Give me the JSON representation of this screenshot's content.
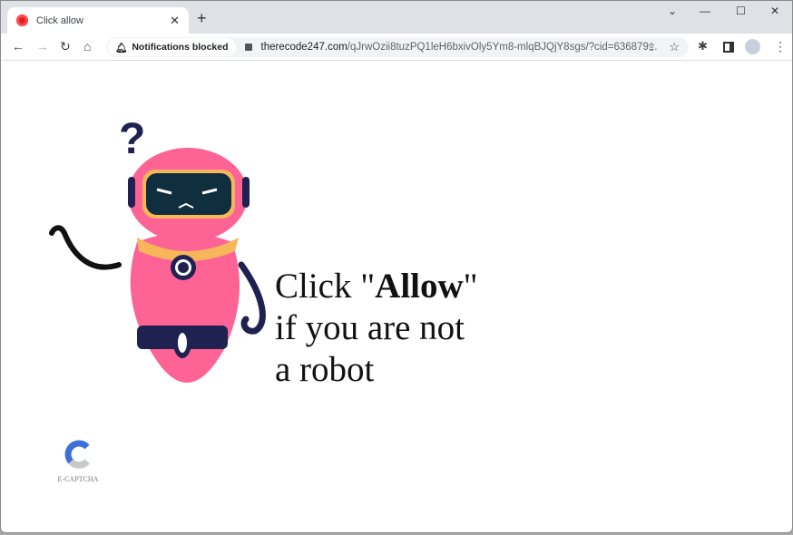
{
  "tab": {
    "title": "Click allow",
    "close": "✕",
    "new_tab": "+"
  },
  "window": {
    "dropdown": "⌄",
    "minimize": "—",
    "maximize": "☐",
    "close": "✕"
  },
  "toolbar": {
    "back": "←",
    "forward": "→",
    "reload": "↻",
    "home": "⌂",
    "notifications_chip": "Notifications blocked",
    "url_domain": "therecode247.com",
    "url_path": "/qJrwOzii8tuzPQ1leH6bxivOly5Ym8-mlqBJQjY8sgs/?cid=636879..."
  },
  "page": {
    "line1_pre": "Click \"",
    "line1_bold": "Allow",
    "line1_post": "\"",
    "line2": "if you are not",
    "line3": "a robot",
    "question_mark": "?",
    "logo_text": "E-CAPTCHA"
  },
  "colors": {
    "robot_pink": "#fd6395",
    "robot_navy": "#1f2150",
    "collar": "#f7b65a"
  }
}
